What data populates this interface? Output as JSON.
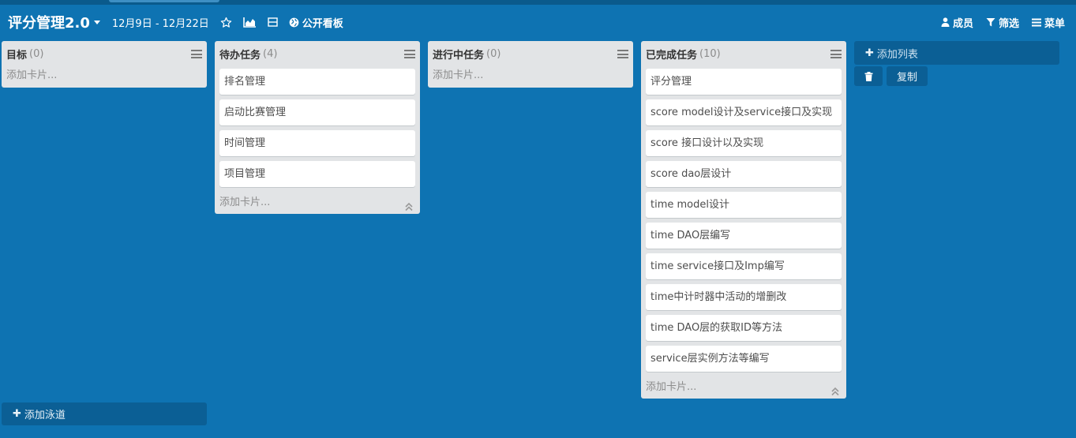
{
  "header": {
    "title": "评分管理2.0",
    "date_range": "12月9日 - 12月22日",
    "public_label": "公开看板",
    "members_label": "成员",
    "filter_label": "筛选",
    "menu_label": "菜单"
  },
  "lists": [
    {
      "title": "目标",
      "count": "(0)",
      "cards": [],
      "add_card_label": "添加卡片..."
    },
    {
      "title": "待办任务",
      "count": "(4)",
      "cards": [
        "排名管理",
        "启动比赛管理",
        "时间管理",
        "项目管理"
      ],
      "add_card_label": "添加卡片..."
    },
    {
      "title": "进行中任务",
      "count": "(0)",
      "cards": [],
      "add_card_label": "添加卡片..."
    },
    {
      "title": "已完成任务",
      "count": "(10)",
      "cards": [
        "评分管理",
        "score model设计及service接口及实现",
        "score 接口设计以及实现",
        "score dao层设计",
        "time model设计",
        "time DAO层编写",
        "time service接口及Imp编写",
        "time中计时器中活动的增删改",
        "time DAO层的获取ID等方法",
        "service层实例方法等编写"
      ],
      "add_card_label": "添加卡片..."
    }
  ],
  "add_list_label": "添加列表",
  "copy_label": "复制",
  "add_lane_label": "添加泳道",
  "colors": {
    "board_bg": "#0e73b2",
    "list_bg": "#e2e4e6",
    "button_bg": "#0b5f95"
  },
  "icons": [
    "caret-down-icon",
    "star-icon",
    "chart-icon",
    "calendar-icon",
    "globe-icon",
    "user-icon",
    "filter-icon",
    "menu-icon",
    "list-menu-icon",
    "collapse-icon",
    "plus-icon",
    "trash-icon"
  ]
}
